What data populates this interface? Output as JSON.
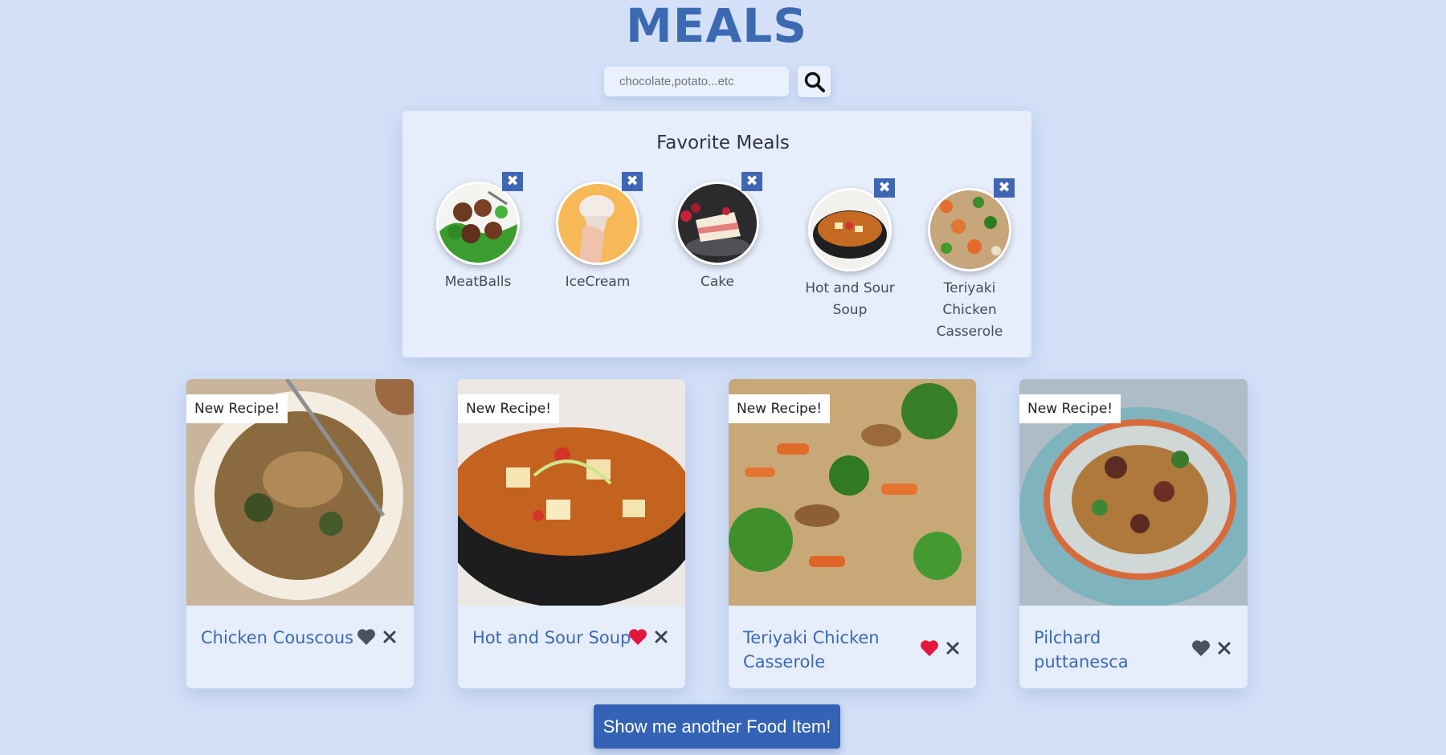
{
  "app": {
    "title": "MEALS"
  },
  "search": {
    "placeholder": "chocolate,potato...etc"
  },
  "favorites": {
    "heading": "Favorite Meals",
    "items": [
      {
        "name": "MeatBalls"
      },
      {
        "name": "IceCream"
      },
      {
        "name": "Cake"
      },
      {
        "name": "Hot and Sour Soup"
      },
      {
        "name": "Teriyaki Chicken Casserole"
      }
    ]
  },
  "meals": [
    {
      "badge": "New Recipe!",
      "name": "Chicken Couscous",
      "favorited": false
    },
    {
      "badge": "New Recipe!",
      "name": "Hot and Sour Soup",
      "favorited": true
    },
    {
      "badge": "New Recipe!",
      "name": "Teriyaki Chicken Casserole",
      "favorited": true
    },
    {
      "badge": "New Recipe!",
      "name": "Pilchard puttanesca",
      "favorited": false
    }
  ],
  "actions": {
    "show_another": "Show me another Food Item!"
  },
  "colors": {
    "background": "#d3e0f8",
    "brand": "#3b6ab2",
    "heart_active": "#e3173e",
    "heart_inactive": "#4b5260"
  }
}
